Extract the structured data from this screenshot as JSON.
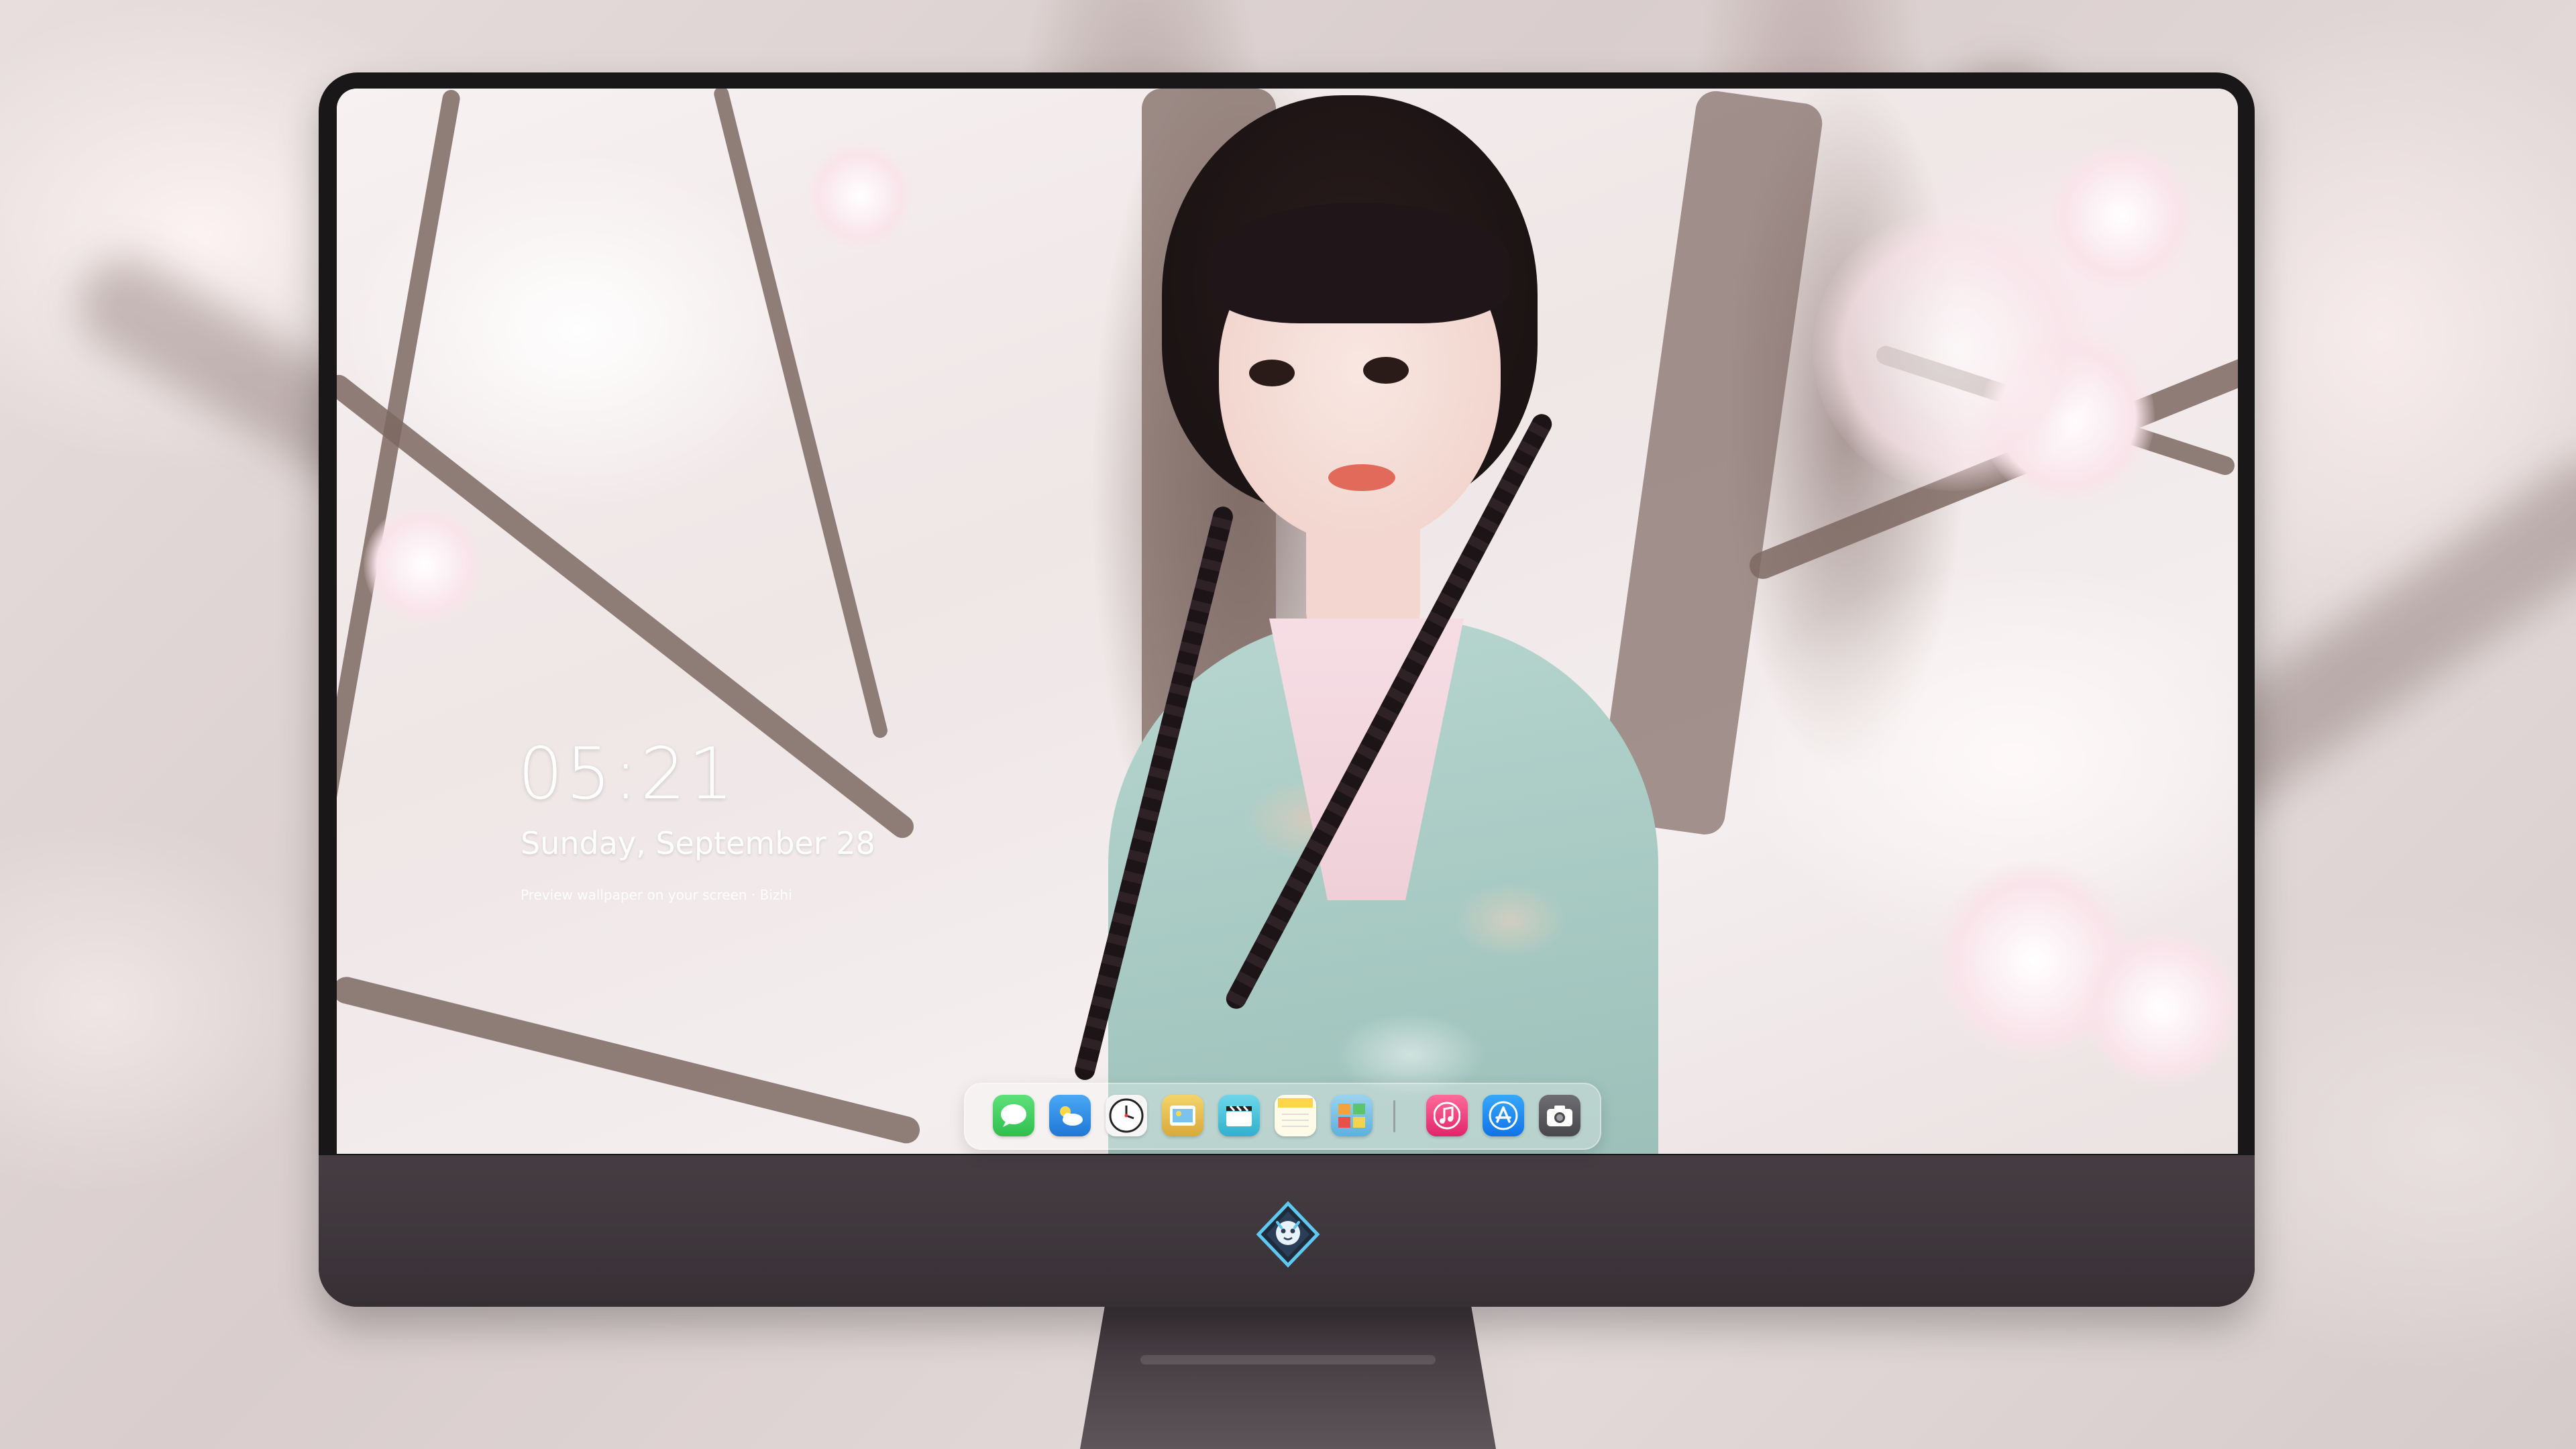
{
  "clock": {
    "time": "05:21",
    "date": "Sunday, September 28",
    "subtitle": "Preview wallpaper on your screen · Bizhi"
  },
  "dock": {
    "apps": [
      {
        "name": "Messages",
        "icon": "messages-icon",
        "color": "#34c759"
      },
      {
        "name": "Weather",
        "icon": "weather-icon",
        "color": "#2f8ff0"
      },
      {
        "name": "Clock",
        "icon": "clock-icon",
        "color": "#ffffff"
      },
      {
        "name": "Preview",
        "icon": "preview-icon",
        "color": "#e8c24a"
      },
      {
        "name": "Clips",
        "icon": "clips-icon",
        "color": "#4fc3d9"
      },
      {
        "name": "Notes",
        "icon": "notes-icon",
        "color": "#ffd54a"
      },
      {
        "name": "Photo Booth",
        "icon": "photo-booth-icon",
        "color": "#7cc0e0"
      },
      {
        "name": "Music",
        "icon": "music-icon",
        "color": "#fa3e78"
      },
      {
        "name": "App Store",
        "icon": "app-store-icon",
        "color": "#1c8ef5"
      },
      {
        "name": "Screenshot",
        "icon": "camera-icon",
        "color": "#5a5a5e"
      }
    ]
  },
  "colors": {
    "bezel": "#1a1719",
    "chin": "#3d363b",
    "dock_bg": "rgba(255,255,255,0.28)"
  }
}
